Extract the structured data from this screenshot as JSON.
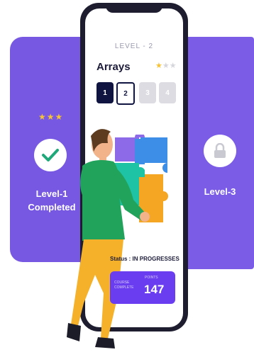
{
  "levels": {
    "completed": {
      "label": "Level-1 Completed",
      "line1": "Level-1",
      "line2": "Completed",
      "stars": "★★★"
    },
    "locked": {
      "label": "Level-3"
    }
  },
  "phone": {
    "level_title": "LEVEL - 2",
    "topic_title": "Arrays",
    "rating": {
      "on": "★",
      "off": "★★"
    },
    "tiles": [
      "1",
      "2",
      "3",
      "4"
    ],
    "status": "Status : IN PROGRESSES",
    "score_card": {
      "label_left": "COURSE COMPLETE",
      "label_points": "POINTS",
      "points": "147"
    }
  },
  "colors": {
    "accent": "#7658e3",
    "star": "#f6c236",
    "navy": "#0f1440",
    "score_bg": "#6a3ef0"
  },
  "icons": [
    "check-icon",
    "lock-icon",
    "star-icon",
    "puzzle-illustration",
    "person-illustration"
  ]
}
